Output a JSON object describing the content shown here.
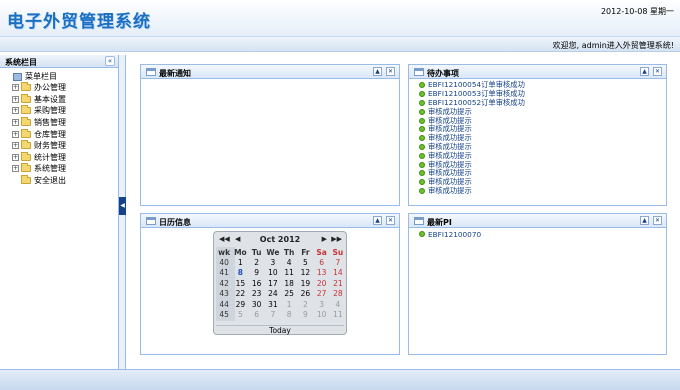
{
  "header": {
    "title": "电子外贸管理系统",
    "date": "2012-10-08 星期一"
  },
  "topbar": {
    "welcome": "欢迎您, admin进入外贸管理系统!"
  },
  "sidebar": {
    "title": "系统栏目",
    "collapse_label": "«",
    "root": "菜单栏目",
    "items": [
      {
        "label": "办公管理",
        "expand": "+"
      },
      {
        "label": "基本设置",
        "expand": "+"
      },
      {
        "label": "采购管理",
        "expand": "+"
      },
      {
        "label": "销售管理",
        "expand": "+"
      },
      {
        "label": "仓库管理",
        "expand": "+"
      },
      {
        "label": "财务管理",
        "expand": "+"
      },
      {
        "label": "统计管理",
        "expand": "+"
      },
      {
        "label": "系统管理",
        "expand": "+"
      },
      {
        "label": "安全退出",
        "expand": ""
      }
    ]
  },
  "splitter": {
    "label": "◀"
  },
  "panels": {
    "notice": {
      "title": "最新通知",
      "min": "▲",
      "close": "✕"
    },
    "todo": {
      "title": "待办事项",
      "min": "▲",
      "close": "✕",
      "items": [
        "EBFI12100054订单审核成功",
        "EBFI12100053订单审核成功",
        "EBFI12100052订单审核成功",
        "审核成功提示",
        "审核成功提示",
        "审核成功提示",
        "审核成功提示",
        "审核成功提示",
        "审核成功提示",
        "审核成功提示",
        "审核成功提示",
        "审核成功提示",
        "审核成功提示"
      ]
    },
    "calendar": {
      "title": "日历信息",
      "min": "▲",
      "close": "✕"
    },
    "latest": {
      "title": "最新PI",
      "min": "▲",
      "close": "✕",
      "items": [
        "EBFI12100070"
      ]
    }
  },
  "calendar": {
    "month": "Oct 2012",
    "prev_year": "◀◀",
    "prev_month": "◀",
    "next_month": "▶",
    "next_year": "▶▶",
    "headers": [
      "wk",
      "Mo",
      "Tu",
      "We",
      "Th",
      "Fr",
      "Sa",
      "Su"
    ],
    "weeks": [
      [
        "40",
        "1",
        "2",
        "3",
        "4",
        "5",
        "6",
        "7"
      ],
      [
        "41",
        "8",
        "9",
        "10",
        "11",
        "12",
        "13",
        "14"
      ],
      [
        "42",
        "15",
        "16",
        "17",
        "18",
        "19",
        "20",
        "21"
      ],
      [
        "43",
        "22",
        "23",
        "24",
        "25",
        "26",
        "27",
        "28"
      ],
      [
        "44",
        "29",
        "30",
        "31",
        "1",
        "2",
        "3",
        "4"
      ],
      [
        "45",
        "5",
        "6",
        "7",
        "8",
        "9",
        "10",
        "11"
      ]
    ],
    "today_label": "Today",
    "today_day": "8",
    "colors": {
      "weekend": "#c83232",
      "other_month": "#999999",
      "today": "#1f4fb8"
    }
  }
}
